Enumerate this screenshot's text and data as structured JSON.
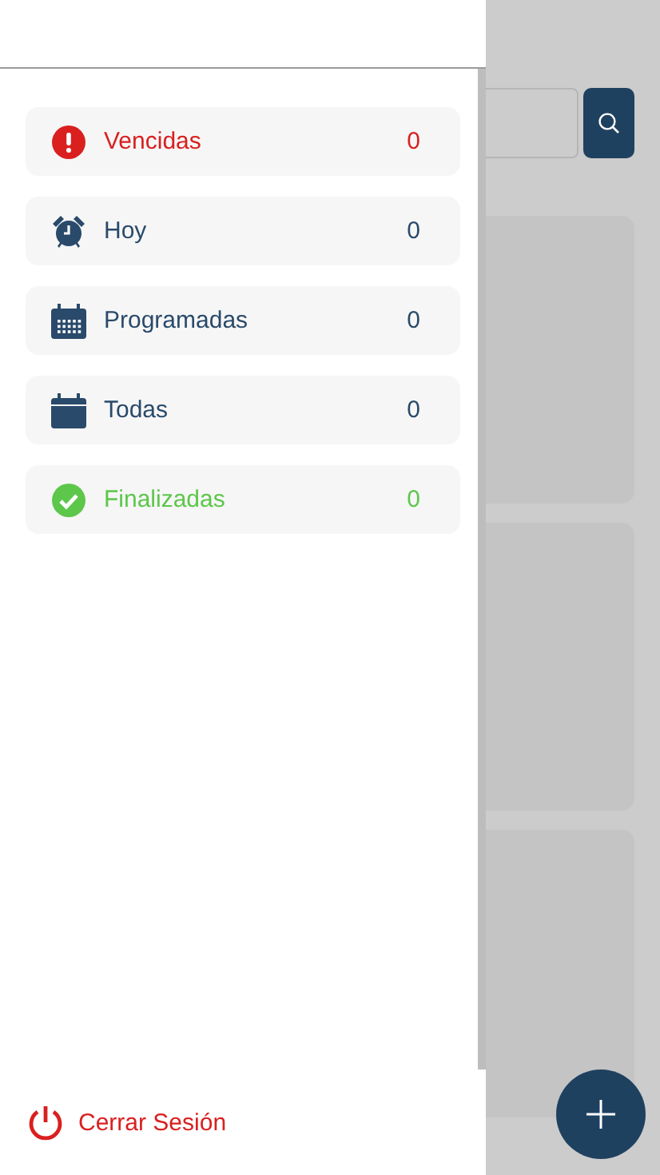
{
  "filters": [
    {
      "kind": "overdue",
      "label": "Vencidas",
      "count": "0",
      "color": "#d9201f"
    },
    {
      "kind": "today",
      "label": "Hoy",
      "count": "0",
      "color": "#2a4a6b"
    },
    {
      "kind": "scheduled",
      "label": "Programadas",
      "count": "0",
      "color": "#2a4a6b"
    },
    {
      "kind": "all",
      "label": "Todas",
      "count": "0",
      "color": "#2a4a6b"
    },
    {
      "kind": "done",
      "label": "Finalizadas",
      "count": "0",
      "color": "#5cc74a"
    }
  ],
  "logout": {
    "label": "Cerrar Sesión"
  }
}
